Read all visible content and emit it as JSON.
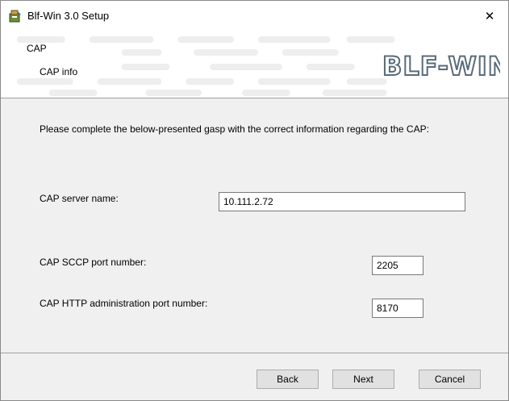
{
  "window": {
    "title": "Blf-Win 3.0 Setup",
    "close_glyph": "✕",
    "app_icon": "installer-icon",
    "close_icon": "close-icon"
  },
  "banner": {
    "title": "CAP",
    "subtitle": "CAP info",
    "logo_text": "BLF-WIN"
  },
  "content": {
    "description": "Please complete the below-presented gasp with the correct information regarding the CAP:",
    "fields": {
      "server_name": {
        "label": "CAP server name:",
        "value": "10.111.2.72"
      },
      "sccp_port": {
        "label": "CAP SCCP port number:",
        "value": "2205"
      },
      "http_port": {
        "label": "CAP HTTP administration port number:",
        "value": "8170"
      }
    }
  },
  "buttons": {
    "back": "Back",
    "next": "Next",
    "cancel": "Cancel"
  },
  "colors": {
    "dialog_bg": "#f0f0f0",
    "banner_bg": "#ffffff",
    "logo_outline": "#5a6b7a",
    "pattern": "#e6e6e6"
  }
}
